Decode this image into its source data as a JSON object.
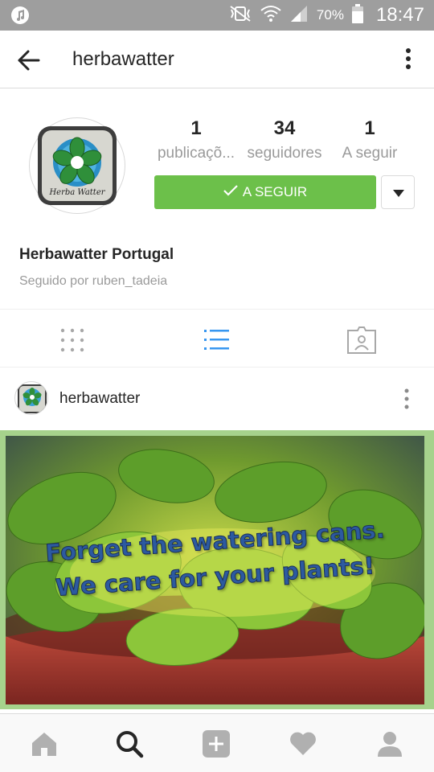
{
  "status_bar": {
    "battery_percent": "70%",
    "time": "18:47",
    "icons": [
      "music-note-icon",
      "vibrate-mute-icon",
      "wifi-icon",
      "signal-icon",
      "battery-icon"
    ]
  },
  "app_bar": {
    "title": "herbawatter",
    "back_icon": "arrow-left-icon",
    "menu_icon": "more-vertical-icon"
  },
  "profile": {
    "stats": [
      {
        "value": "1",
        "label": "publicaçõ..."
      },
      {
        "value": "34",
        "label": "seguidores"
      },
      {
        "value": "1",
        "label": "A seguir"
      }
    ],
    "follow_button_label": "A SEGUIR",
    "full_name": "Herbawatter Portugal",
    "followed_by": "Seguido por ruben_tadeia",
    "avatar_text": "Herba Watter"
  },
  "tabs": [
    {
      "icon": "grid-icon",
      "active": false
    },
    {
      "icon": "list-icon",
      "active": true
    },
    {
      "icon": "tagged-person-icon",
      "active": false
    }
  ],
  "post": {
    "username": "herbawatter",
    "image_caption_line1": "Forget the watering cans.",
    "image_caption_line2": "We care for your plants!"
  },
  "bottom_nav": [
    {
      "icon": "home-icon",
      "active": false
    },
    {
      "icon": "search-icon",
      "active": true
    },
    {
      "icon": "add-post-icon",
      "active": false
    },
    {
      "icon": "heart-icon",
      "active": false
    },
    {
      "icon": "profile-icon",
      "active": false
    }
  ],
  "colors": {
    "status_bar": "#9e9e9e",
    "follow_green": "#6cc04a",
    "active_tab_blue": "#3897f0",
    "image_frame": "#a6d28c"
  }
}
